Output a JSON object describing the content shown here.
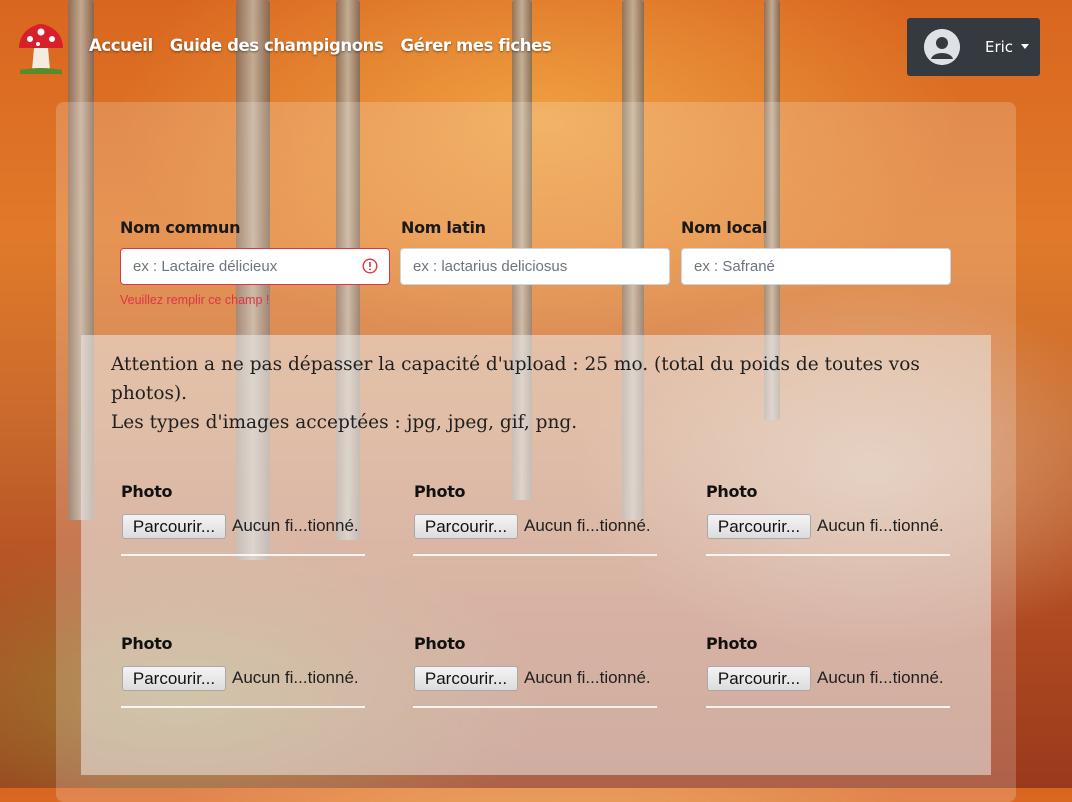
{
  "navbar": {
    "links": [
      {
        "label": "Accueil"
      },
      {
        "label": "Guide des champignons"
      },
      {
        "label": "Gérer mes fiches"
      }
    ],
    "user": {
      "name": "Eric",
      "avatar_icon": "user-circle-icon"
    },
    "logo_icon": "mushroom-logo-icon",
    "colors": {
      "user_box": "#343a40",
      "link": "#ffffff"
    }
  },
  "form": {
    "fields": [
      {
        "label": "Nom commun",
        "placeholder": "ex : Lactaire délicieux",
        "value": "",
        "invalid": true
      },
      {
        "label": "Nom latin",
        "placeholder": "ex : lactarius deliciosus",
        "value": ""
      },
      {
        "label": "Nom local",
        "placeholder": "ex : Safrané",
        "value": ""
      }
    ],
    "error_message": "Veuillez remplir ce champ !",
    "colors": {
      "error": "#dc3545"
    }
  },
  "upload": {
    "notice_lines": [
      "Attention a ne pas dépasser la capacité d'upload : 25 mo. (total du poids de toutes vos photos).",
      "Les types d'images acceptées : jpg, jpeg, gif, png."
    ],
    "photos": [
      {
        "label": "Photo",
        "button": "Parcourir...",
        "status": "Aucun fi...tionné."
      },
      {
        "label": "Photo",
        "button": "Parcourir...",
        "status": "Aucun fi...tionné."
      },
      {
        "label": "Photo",
        "button": "Parcourir...",
        "status": "Aucun fi...tionné."
      },
      {
        "label": "Photo",
        "button": "Parcourir...",
        "status": "Aucun fi...tionné."
      },
      {
        "label": "Photo",
        "button": "Parcourir...",
        "status": "Aucun fi...tionné."
      },
      {
        "label": "Photo",
        "button": "Parcourir...",
        "status": "Aucun fi...tionné."
      }
    ]
  }
}
